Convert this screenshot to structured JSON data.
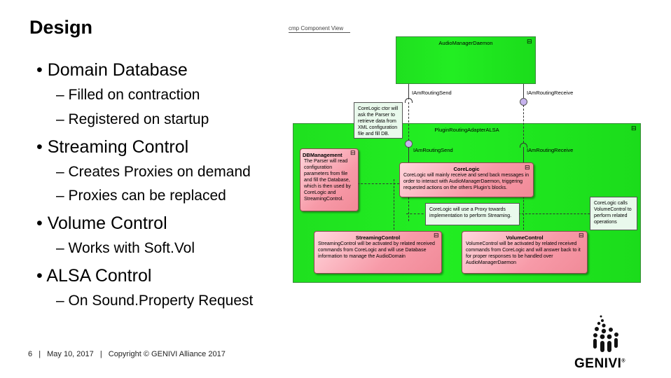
{
  "slide": {
    "title": "Design",
    "bullets": [
      {
        "text": "• Domain Database",
        "subs": [
          "– Filled on contraction",
          "– Registered on startup"
        ]
      },
      {
        "text": "• Streaming Control",
        "subs": [
          "– Creates Proxies on demand",
          "– Proxies can be replaced"
        ]
      },
      {
        "text": "• Volume Control",
        "subs": [
          "– Works with Soft.Vol"
        ]
      },
      {
        "text": "• ALSA Control",
        "subs": [
          "– On Sound.Property Request"
        ]
      }
    ]
  },
  "diagram": {
    "frame_label": "cmp Component View",
    "audio_manager": "AudioManagerDaemon",
    "plugin": "PluginRoutingAdapterALSA",
    "iface_send": "IAmRoutingSend",
    "iface_receive": "IAmRoutingReceive",
    "note_parser": "CoreLogic ctor will ask the Parser to retrieve data from XML configuration file and fill DB.",
    "db_title": "DBManagement",
    "db_body": "The Parser will read configuration parameters from file and fill the Database, which is then used by CoreLogic and StreamingControl.",
    "core_title": "CoreLogic",
    "core_body": "CoreLogic will mainly receive and send back messages in order to interact with AudioManagerDaemon, triggering requested actions on the others Plugin's blocks.",
    "note_proxy": "CoreLogic will use a Proxy towards implementation to perform Streaming.",
    "note_volume": "CoreLogic calls VolumeControl to perform related operations",
    "stream_title": "StreamingControl",
    "stream_body": "StreamingControl will be activated by related received commands from CoreLogic and will use Database information to manage the AudioDomain",
    "volume_title": "VolumeControl",
    "volume_body": "VolumeControl will be activated by related received commands from CoreLogic and will answer back to it for proper responses to be handled over AudioManagerDaemon"
  },
  "footer": {
    "page": "6",
    "sep": "|",
    "date": "May 10, 2017",
    "copyright": "Copyright © GENIVI Alliance 2017"
  },
  "logo": {
    "text": "GENIVI",
    "reg": "®"
  }
}
